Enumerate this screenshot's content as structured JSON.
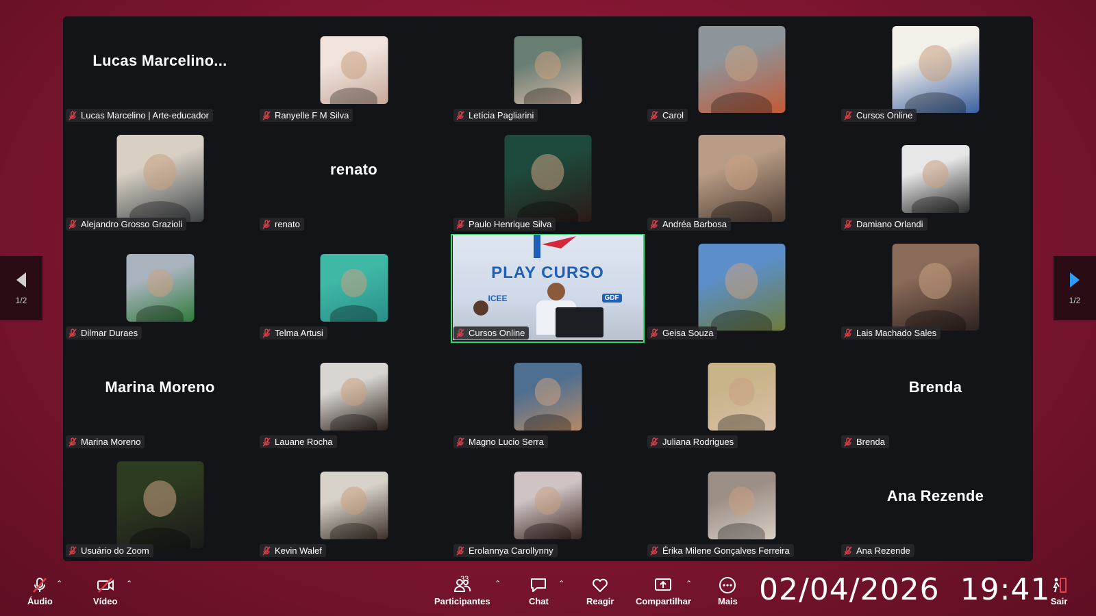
{
  "pager": {
    "left_label": "1/2",
    "right_label": "1/2"
  },
  "participants": [
    {
      "name": "Lucas Marcelino | Arte-educador",
      "display": "Lucas  Marcelino...",
      "kind": "text"
    },
    {
      "name": "Ranyelle F M Silva",
      "kind": "photo-sq",
      "colors": [
        "#efe3dc",
        "#c7a99a"
      ]
    },
    {
      "name": "Letícia Pagliarini",
      "kind": "photo-sq",
      "colors": [
        "#6a7f73",
        "#d9b8a7"
      ]
    },
    {
      "name": "Carol",
      "kind": "photo-big",
      "colors": [
        "#8d949a",
        "#c35a36"
      ]
    },
    {
      "name": "Cursos Online",
      "kind": "photo-big",
      "colors": [
        "#f3f0ea",
        "#3a5fa0"
      ]
    },
    {
      "name": "Alejandro Grosso Grazioli",
      "kind": "photo-big",
      "colors": [
        "#d7d0c3",
        "#3d4348"
      ]
    },
    {
      "name": "renato",
      "display": "renato",
      "kind": "text"
    },
    {
      "name": "Paulo Henrique Silva",
      "kind": "photo-big",
      "colors": [
        "#1d4a3c",
        "#2b1a16"
      ]
    },
    {
      "name": "Andréa Barbosa",
      "kind": "photo-big",
      "colors": [
        "#b89c85",
        "#4a3a32"
      ]
    },
    {
      "name": "Damiano Orlandi",
      "kind": "photo-sq",
      "colors": [
        "#e6e6e6",
        "#2a2a2a"
      ]
    },
    {
      "name": "Dilmar Duraes",
      "kind": "photo-sq",
      "colors": [
        "#a8b3bd",
        "#2f7a3a"
      ]
    },
    {
      "name": "Telma Artusi",
      "kind": "photo-sq",
      "colors": [
        "#3fb8a6",
        "#2a8e86"
      ]
    },
    {
      "name": "Cursos Online",
      "kind": "stream",
      "active": true
    },
    {
      "name": "Geisa Souza",
      "kind": "photo-big",
      "colors": [
        "#5c8fc9",
        "#6d7b3c"
      ]
    },
    {
      "name": "Lais Machado Sales",
      "kind": "photo-big",
      "colors": [
        "#8a6a58",
        "#2c2220"
      ]
    },
    {
      "name": "Marina Moreno",
      "display": "Marina Moreno",
      "kind": "text"
    },
    {
      "name": "Lauane Rocha",
      "kind": "photo-sq",
      "colors": [
        "#d9d6d1",
        "#2b211c"
      ]
    },
    {
      "name": "Magno Lucio Serra",
      "kind": "photo-sq",
      "colors": [
        "#4f6f91",
        "#b58a67"
      ]
    },
    {
      "name": "Juliana Rodrigues",
      "kind": "photo-sq",
      "colors": [
        "#c9b48a",
        "#d7c0a8"
      ]
    },
    {
      "name": "Brenda",
      "display": "Brenda",
      "kind": "text"
    },
    {
      "name": "Usuário do Zoom",
      "kind": "photo-big",
      "colors": [
        "#2d3b20",
        "#1a1a1a"
      ]
    },
    {
      "name": "Kevin Walef",
      "kind": "photo-sq",
      "colors": [
        "#d8d3c9",
        "#3b3027"
      ]
    },
    {
      "name": "Erolannya Carollynny",
      "kind": "photo-sq",
      "colors": [
        "#cfc3c4",
        "#3a241e"
      ]
    },
    {
      "name": "Érika Milene Gonçalves Ferreira",
      "kind": "photo-sq",
      "colors": [
        "#9c8f86",
        "#d8cfc6"
      ]
    },
    {
      "name": "Ana Rezende",
      "display": "Ana Rezende",
      "kind": "text"
    }
  ],
  "stream": {
    "banner": "PLAY CURSO",
    "logo_left": "ICEE",
    "logo_right": "GDF"
  },
  "toolbar": {
    "audio": "Áudio",
    "video": "Vídeo",
    "participants": "Participantes",
    "participants_count": "33",
    "chat": "Chat",
    "react": "Reagir",
    "share": "Compartilhar",
    "more": "Mais",
    "leave": "Sair"
  },
  "clock": {
    "date": "02/04/2026",
    "time": "19:41"
  },
  "colors": {
    "active_border": "#2ee06a",
    "mic_off": "#e0404a",
    "background": "#7d1530"
  }
}
